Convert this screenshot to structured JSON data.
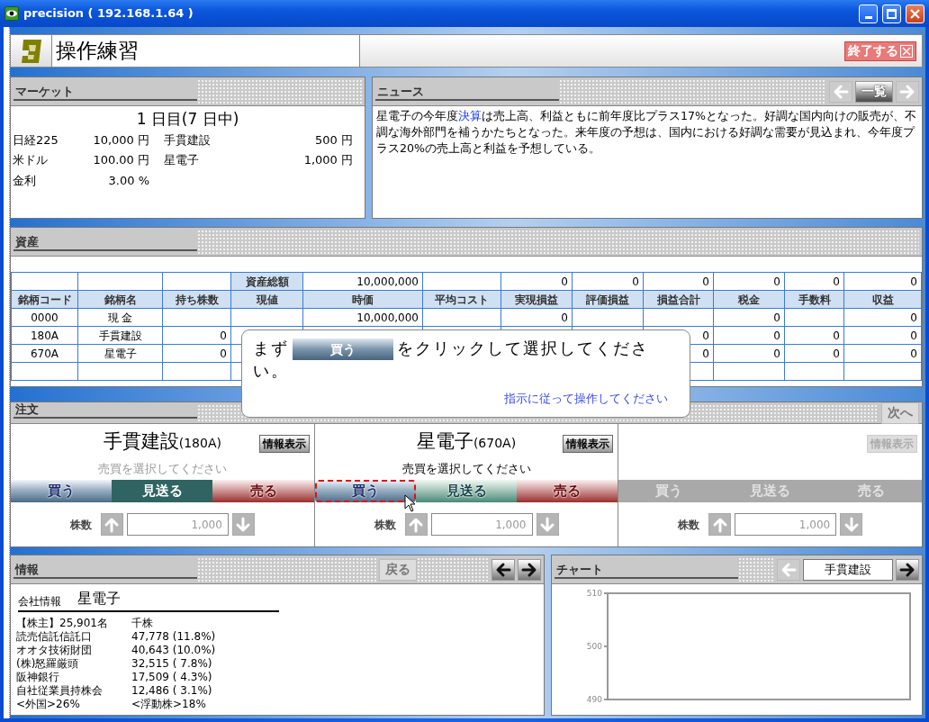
{
  "window": {
    "title": "precision ( 192.168.1.64 )"
  },
  "header": {
    "title": "操作練習",
    "exit_button": "終了する"
  },
  "market": {
    "title": "マーケット",
    "day": "1 日目(7 日中)",
    "rows": [
      {
        "label": "日経225",
        "value": "10,000 円",
        "stock": "手貫建設",
        "price": "500 円"
      },
      {
        "label": "米ドル",
        "value": "100.00 円",
        "stock": "星電子",
        "price": "1,000 円"
      },
      {
        "label": "金利",
        "value": "3.00 %"
      }
    ]
  },
  "news": {
    "title": "ニュース",
    "prev_disabled": true,
    "list_button": "一覧",
    "next_disabled": true,
    "text_before": "星電子の今年度",
    "link": "決算",
    "text_after": "は売上高、利益ともに前年度比プラス17%となった。好調な国内向けの販売が、不調な海外部門を補うかたちとなった。来年度の予想は、国内における好調な需要が見込まれ、今年度プラス20%の売上高と利益を予想している。"
  },
  "assets": {
    "title": "資産",
    "summary": {
      "label": "資産総額",
      "market_value": "10,000,000",
      "realized": "0",
      "unrealized": "0",
      "total": "0",
      "tax": "0",
      "fee": "0",
      "profit": "0"
    },
    "columns": [
      "銘柄コード",
      "銘柄名",
      "持ち株数",
      "現値",
      "時価",
      "平均コスト",
      "実現損益",
      "評価損益",
      "損益合計",
      "税金",
      "手数料",
      "収益"
    ],
    "rows": [
      {
        "code": "0000",
        "name": "現 金",
        "market_value": "10,000,000",
        "realized": "0",
        "tax": "0",
        "profit": "0"
      },
      {
        "code": "180A",
        "name": "手貫建設",
        "shares": "0",
        "total": "0",
        "tax": "0",
        "fee": "0",
        "profit": "0"
      },
      {
        "code": "670A",
        "name": "星電子",
        "shares": "0",
        "total": "0",
        "tax": "0",
        "fee": "0",
        "profit": "0"
      }
    ]
  },
  "guide": {
    "before": "まず",
    "button": "買う",
    "after": "をクリックして選択してください。",
    "hint": "指示に従って操作してください"
  },
  "order": {
    "title": "注文",
    "next_button": {
      "label": "次へ",
      "disabled": true
    },
    "slots": [
      {
        "name": "手貫建設",
        "code": "(180A)",
        "info_button": {
          "label": "情報表示",
          "disabled": false
        },
        "prompt": "売買を選択してください",
        "prompt_dimmed": true,
        "disabled": false,
        "actions": [
          {
            "kind": "buy",
            "label": "買う",
            "selected": false,
            "highlighted": false
          },
          {
            "kind": "pass",
            "label": "見送る",
            "selected": true,
            "highlighted": false
          },
          {
            "kind": "sell",
            "label": "売る",
            "selected": false,
            "highlighted": false
          }
        ],
        "shares_label": "株数",
        "quantity": "1,000"
      },
      {
        "name": "星電子",
        "code": "(670A)",
        "info_button": {
          "label": "情報表示",
          "disabled": false
        },
        "prompt": "売買を選択してください",
        "prompt_dimmed": false,
        "disabled": false,
        "actions": [
          {
            "kind": "buy",
            "label": "買う",
            "selected": false,
            "highlighted": true
          },
          {
            "kind": "pass",
            "label": "見送る",
            "selected": false,
            "highlighted": false
          },
          {
            "kind": "sell",
            "label": "売る",
            "selected": false,
            "highlighted": false
          }
        ],
        "shares_label": "株数",
        "quantity": "1,000"
      },
      {
        "info_button": {
          "label": "情報表示",
          "disabled": true
        },
        "disabled": true,
        "actions": [
          {
            "kind": "buy",
            "label": "買う",
            "selected": false,
            "highlighted": false
          },
          {
            "kind": "pass",
            "label": "見送る",
            "selected": false,
            "highlighted": false
          },
          {
            "kind": "sell",
            "label": "売る",
            "selected": false,
            "highlighted": false
          }
        ],
        "shares_label": "株数",
        "quantity": "1,000"
      }
    ]
  },
  "info": {
    "title": "情報",
    "back_button": {
      "label": "戻る",
      "disabled": true
    },
    "prev_disabled": false,
    "next_disabled": false,
    "heading": "会社情報",
    "company": "星電子",
    "lines": [
      {
        "name": "【株主】25,901名",
        "value": "千株"
      },
      {
        "name": "読売信託信託口",
        "value": "47,778 (11.8%)"
      },
      {
        "name": "オオタ技術財団",
        "value": "40,643 (10.0%)"
      },
      {
        "name": "(株)怒羅厳頭",
        "value": "32,515 ( 7.8%)"
      },
      {
        "name": "阪神銀行",
        "value": "17,509 ( 4.3%)"
      },
      {
        "name": "自社従業員持株会",
        "value": "12,486 ( 3.1%)"
      },
      {
        "name": "<外国>26%",
        "value": "<浮動株>18%"
      }
    ]
  },
  "chart": {
    "title": "チャート",
    "prev_disabled": true,
    "next_disabled": false,
    "stock": "手貫建設",
    "axis_labels": [
      "510",
      "500",
      "490"
    ]
  }
}
